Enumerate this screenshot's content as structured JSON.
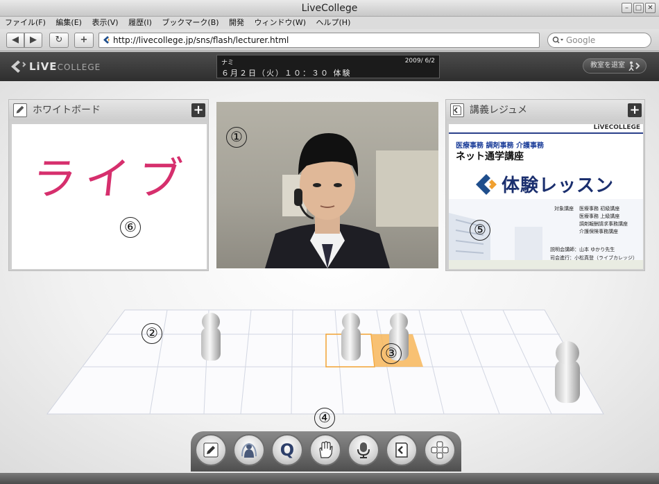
{
  "window": {
    "title": "LiveCollege"
  },
  "menu": [
    "ファイル(F)",
    "編集(E)",
    "表示(V)",
    "履歴(I)",
    "ブックマーク(B)",
    "開発",
    "ウィンドウ(W)",
    "ヘルプ(H)"
  ],
  "nav": {
    "url": "http://livecollege.jp/sns/flash/lecturer.html",
    "search_placeholder": "Google",
    "back": "◀",
    "forward": "▶",
    "reload": "↻",
    "newtab": "+"
  },
  "app": {
    "logo_main": "LiVE",
    "logo_sub": "COLLEGE",
    "info_name": "ナミ",
    "info_date": "2009/ 6/2",
    "info_lecture": "６月２日（火）１０：３０ 体験",
    "leave_label": "教室を退室"
  },
  "whiteboard": {
    "title": "ホワイトボード",
    "drawing_text": "ライブ",
    "marker": "⑥",
    "plus": "+"
  },
  "video": {
    "marker": "①"
  },
  "resume": {
    "title": "講義レジュメ",
    "marker": "⑤",
    "plus": "+",
    "slide": {
      "brand": "LiVECOLLEGE",
      "subjects": "医療事務  調剤事務  介護事務",
      "course": "ネット通学講座",
      "headline": "体験レッスン",
      "target_label": "対象講座",
      "targets": [
        "医療事務 初級講座",
        "医療事務 上級講座",
        "調剤報酬請求事務講座",
        "介護保険事務講座"
      ],
      "lecturer": "説明会講師：山本 ゆかり先生",
      "host": "司会進行：小松真登（ライブカレッジ）"
    }
  },
  "classroom": {
    "marker_grid": "②",
    "marker_seat": "③",
    "marker_tools": "④"
  },
  "toolbar": [
    "pencil-icon",
    "speaker-icon",
    "question-icon",
    "hand-icon",
    "microphone-icon",
    "book-icon",
    "move-icon"
  ],
  "toolbar_q": "Q",
  "colors": {
    "accent": "#f5b24a",
    "header": "#3a3a3a",
    "ink": "#d6336c"
  }
}
